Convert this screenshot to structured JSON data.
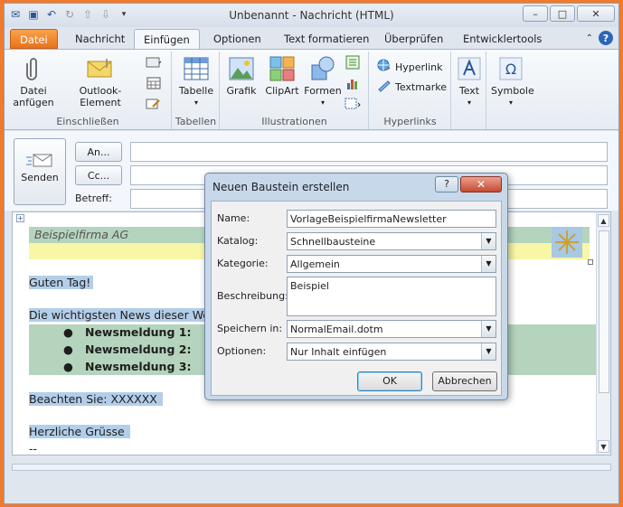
{
  "window": {
    "title": "Unbenannt - Nachricht (HTML)",
    "minimize": "–",
    "maximize": "□",
    "close": "✕"
  },
  "tabs": [
    "Datei",
    "Nachricht",
    "Einfügen",
    "Optionen",
    "Text formatieren",
    "Überprüfen",
    "Entwicklertools"
  ],
  "ribbon": {
    "groups": {
      "include": "Einschließen",
      "tables": "Tabellen",
      "illustrations": "Illustrationen",
      "links": "Hyperlinks"
    },
    "buttons": {
      "attach_file": "Datei anfügen",
      "outlook_item": "Outlook-Element",
      "table": "Tabelle",
      "picture": "Grafik",
      "clipart": "ClipArt",
      "shapes": "Formen",
      "hyperlink": "Hyperlink",
      "bookmark": "Textmarke",
      "text": "Text",
      "symbols": "Symbole"
    }
  },
  "header": {
    "send": "Senden",
    "to": "An...",
    "cc": "Cc...",
    "subject": "Betreff:"
  },
  "editor": {
    "company": "Beispielfirma AG",
    "greeting": "Guten Tag!",
    "news_intro": "Die wichtigsten News dieser Wo",
    "news": [
      "Newsmeldung 1:",
      "Newsmeldung 2:",
      "Newsmeldung 3:"
    ],
    "note": "Beachten Sie: XXXXXX",
    "closing": "Herzliche Grüsse",
    "signature": "--"
  },
  "dialog": {
    "title": "Neuen Baustein erstellen",
    "help": "?",
    "close": "✕",
    "name_label": "Name:",
    "name_value": "VorlageBeispielfirmaNewsletter",
    "gallery_label": "Katalog:",
    "gallery_value": "Schnellbausteine",
    "category_label": "Kategorie:",
    "category_value": "Allgemein",
    "description_label": "Beschreibung:",
    "description_value": "Beispiel",
    "save_label": "Speichern in:",
    "save_value": "NormalEmail.dotm",
    "options_label": "Optionen:",
    "options_value": "Nur Inhalt einfügen",
    "ok": "OK",
    "cancel": "Abbrechen"
  },
  "colors": {
    "file_tab": "#e8731c",
    "accent": "#2b5797",
    "selection": "#b3cee9"
  }
}
